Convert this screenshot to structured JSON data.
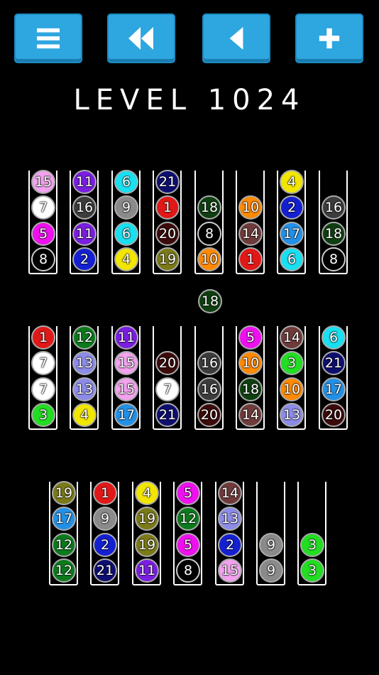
{
  "toolbar": {
    "menu_icon": "hamburger-icon",
    "rewind_icon": "rewind-icon",
    "undo_icon": "back-icon",
    "add_icon": "plus-icon",
    "button_color": "#2ea6e0"
  },
  "title": "LEVEL 1024",
  "held_ball": "18",
  "colors": {
    "1": "#e11818",
    "2": "#1420d0",
    "3": "#22dd22",
    "4": "#f2e600",
    "5": "#ee10ee",
    "6": "#18e0f0",
    "7": "#ffffff",
    "8": "#000000",
    "9": "#8a8a8a",
    "10": "#ff8a00",
    "11": "#7a1ee0",
    "12": "#0c7a1c",
    "13": "#8c8ce8",
    "14": "#6e3a3a",
    "15": "#f2a2ee",
    "16": "#3c3c3c",
    "17": "#2290e6",
    "18": "#0f3f10",
    "19": "#7a7a18",
    "20": "#3c0a0a",
    "21": "#0e0e70"
  },
  "rows": [
    [
      [
        "15",
        "7",
        "5",
        "8"
      ],
      [
        "11",
        "16",
        "11",
        "2"
      ],
      [
        "6",
        "9",
        "6",
        "4"
      ],
      [
        "21",
        "1",
        "20",
        "19"
      ],
      [
        "18",
        "8",
        "10"
      ],
      [
        "10",
        "14",
        "1"
      ],
      [
        "4",
        "2",
        "17",
        "6"
      ],
      [
        "16",
        "18",
        "8"
      ]
    ],
    [
      [
        "1",
        "7",
        "7",
        "3"
      ],
      [
        "12",
        "13",
        "13",
        "4"
      ],
      [
        "11",
        "15",
        "15",
        "17"
      ],
      [
        "20",
        "7",
        "21"
      ],
      [
        "16",
        "16",
        "20"
      ],
      [
        "5",
        "10",
        "18",
        "14"
      ],
      [
        "14",
        "3",
        "10",
        "13"
      ],
      [
        "6",
        "21",
        "17",
        "20"
      ]
    ],
    [
      [
        "19",
        "17",
        "12",
        "12"
      ],
      [
        "1",
        "9",
        "2",
        "21"
      ],
      [
        "4",
        "19",
        "19",
        "11"
      ],
      [
        "5",
        "12",
        "5",
        "8"
      ],
      [
        "14",
        "13",
        "2",
        "15"
      ],
      [
        "9",
        "9"
      ],
      [
        "3",
        "3"
      ]
    ]
  ]
}
